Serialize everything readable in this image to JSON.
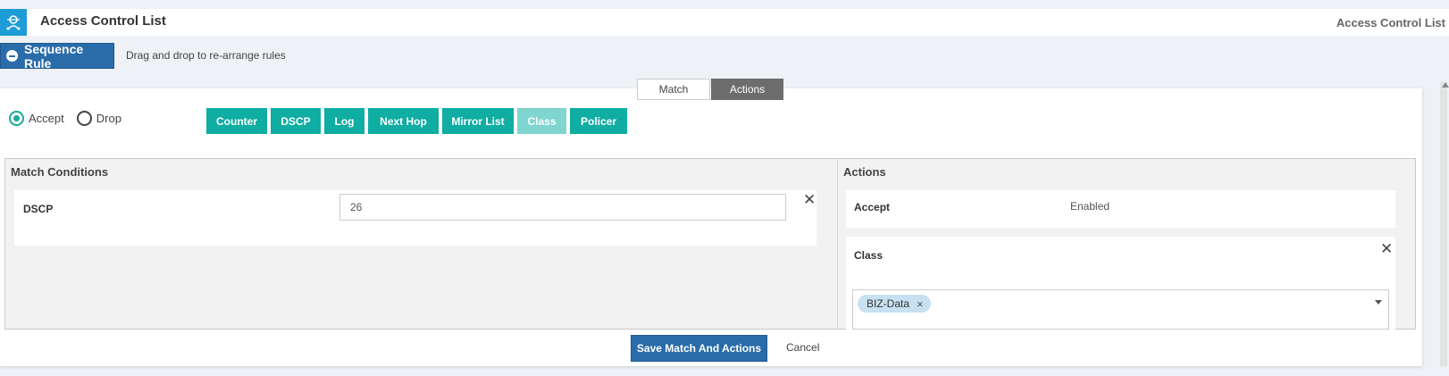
{
  "header": {
    "title": "Access Control List",
    "breadcrumb": "Access Control List",
    "logo_icon": "network-admin-icon"
  },
  "sequence": {
    "button_label": "Sequence Rule",
    "hint": "Drag and drop to re-arrange rules"
  },
  "tabs": [
    {
      "label": "Match",
      "active": false
    },
    {
      "label": "Actions",
      "active": true
    }
  ],
  "radios": [
    {
      "label": "Accept",
      "checked": true
    },
    {
      "label": "Drop",
      "checked": false
    }
  ],
  "action_buttons": [
    {
      "label": "Counter",
      "enabled": true
    },
    {
      "label": "DSCP",
      "enabled": true
    },
    {
      "label": "Log",
      "enabled": true
    },
    {
      "label": "Next Hop",
      "enabled": true
    },
    {
      "label": "Mirror List",
      "enabled": true
    },
    {
      "label": "Class",
      "enabled": false
    },
    {
      "label": "Policer",
      "enabled": true
    }
  ],
  "match_conditions": {
    "title": "Match Conditions",
    "dscp_label": "DSCP",
    "dscp_value": "26"
  },
  "actions_panel": {
    "title": "Actions",
    "accept_label": "Accept",
    "accept_value": "Enabled",
    "class_label": "Class",
    "class_tag": "BIZ-Data"
  },
  "footer": {
    "save_label": "Save Match And Actions",
    "cancel_label": "Cancel"
  },
  "colors": {
    "primary": "#2a6ca9",
    "teal": "#0fada2",
    "teal_disabled": "#7fd5cf",
    "tag_bg": "#c8e1f2"
  }
}
